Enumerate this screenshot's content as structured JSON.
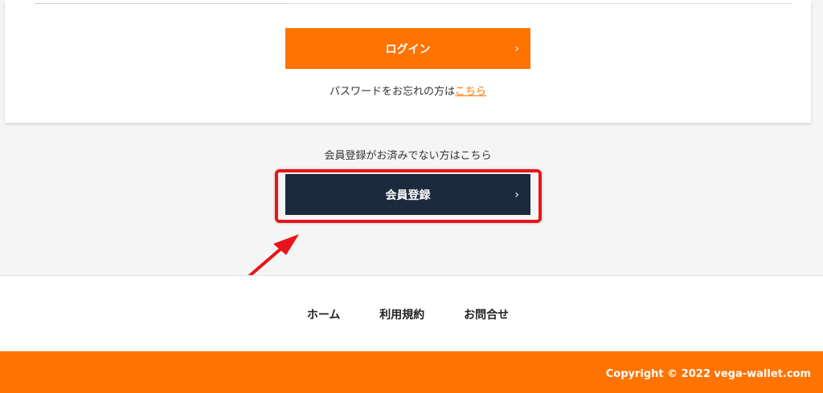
{
  "login": {
    "button_label": "ログイン",
    "chevron": "›",
    "forgot_text": "パスワードをお忘れの方は",
    "forgot_link": "こちら"
  },
  "register": {
    "prompt_text": "会員登録がお済みでない方はこちら",
    "button_label": "会員登録",
    "chevron": "›"
  },
  "footer": {
    "links": [
      "ホーム",
      "利用規約",
      "お問合せ"
    ],
    "copyright": "Copyright © 2022 vega-wallet.com"
  },
  "colors": {
    "accent": "#ff7300",
    "navy": "#1b2a3d",
    "highlight": "#e8141a"
  }
}
